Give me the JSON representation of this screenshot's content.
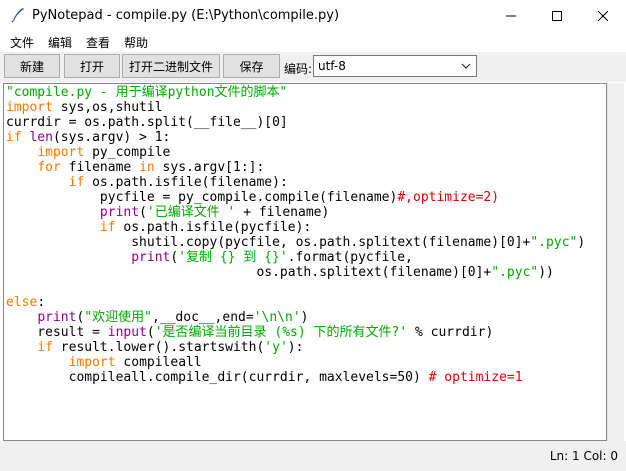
{
  "window": {
    "title": "PyNotepad - compile.py (E:\\Python\\compile.py)",
    "app_icon": "quill-pen-icon",
    "controls": [
      "minimize-icon",
      "maximize-icon",
      "close-icon"
    ]
  },
  "menubar": {
    "items": [
      {
        "label": "文件"
      },
      {
        "label": "编辑"
      },
      {
        "label": "查看"
      },
      {
        "label": "帮助"
      }
    ]
  },
  "toolbar": {
    "new_label": "新建",
    "open_label": "打开",
    "open_binary_label": "打开二进制文件",
    "save_label": "保存",
    "encoding_label": "编码:",
    "encoding_value": "utf-8"
  },
  "editor": {
    "language": "python",
    "lines": [
      "\"compile.py - 用于编译python文件的脚本\"",
      "import sys,os,shutil",
      "currdir = os.path.split(__file__)[0]",
      "if len(sys.argv) > 1:",
      "    import py_compile",
      "    for filename in sys.argv[1:]:",
      "        if os.path.isfile(filename):",
      "            pycfile = py_compile.compile(filename)#,optimize=2)",
      "            print('已编译文件 ' + filename)",
      "            if os.path.isfile(pycfile):",
      "                shutil.copy(pycfile, os.path.splitext(filename)[0]+\".pyc\")",
      "                print('复制 {} 到 {}'.format(pycfile,",
      "                                os.path.splitext(filename)[0]+\".pyc\"))",
      "",
      "else:",
      "    print(\"欢迎使用\",__doc__,end='\\n\\n')",
      "    result = input('是否编译当前目录 (%s) 下的所有文件?' % currdir)",
      "    if result.lower().startswith('y'):",
      "        import compileall",
      "        compileall.compile_dir(currdir, maxlevels=50) # optimize=1"
    ]
  },
  "statusbar": {
    "text": "Ln: 1  Col: 0"
  },
  "colors": {
    "keyword": "#ff7700",
    "builtin": "#900090",
    "string": "#00aa00",
    "comment": "#dd0000"
  }
}
